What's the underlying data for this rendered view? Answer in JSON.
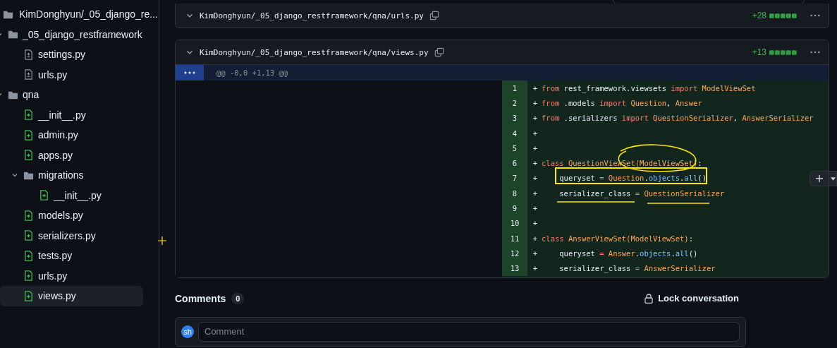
{
  "sidebar": {
    "root": "KimDonghyun/_05_django_re...",
    "tree": [
      {
        "kind": "folder",
        "name": "_05_django_restframework",
        "expanded": true,
        "children": [
          {
            "kind": "modified",
            "name": "settings.py",
            "selected": false
          },
          {
            "kind": "modified",
            "name": "urls.py",
            "selected": false
          }
        ]
      },
      {
        "kind": "folder",
        "name": "qna",
        "expanded": true,
        "children": [
          {
            "kind": "added",
            "name": "__init__.py",
            "selected": false
          },
          {
            "kind": "added",
            "name": "admin.py",
            "selected": false
          },
          {
            "kind": "added",
            "name": "apps.py",
            "selected": false
          },
          {
            "kind": "folder",
            "name": "migrations",
            "expanded": true,
            "children": [
              {
                "kind": "added",
                "name": "__init__.py",
                "selected": false
              }
            ]
          },
          {
            "kind": "added",
            "name": "models.py",
            "selected": false
          },
          {
            "kind": "added",
            "name": "serializers.py",
            "selected": false
          },
          {
            "kind": "added",
            "name": "tests.py",
            "selected": false
          },
          {
            "kind": "added",
            "name": "urls.py",
            "selected": false
          },
          {
            "kind": "added",
            "name": "views.py",
            "selected": true
          }
        ]
      }
    ]
  },
  "files": [
    {
      "path": "KimDonghyun/_05_django_restframework/qna/urls.py",
      "additions": "+28"
    },
    {
      "path": "KimDonghyun/_05_django_restframework/qna/views.py",
      "additions": "+13",
      "hunk": "@@ -0,0 +1,13 @@",
      "lines": [
        {
          "number": "1",
          "tokens": [
            {
              "kind": "keyword",
              "text": "from"
            },
            {
              "kind": "plain",
              "text": " rest_framework.viewsets "
            },
            {
              "kind": "keyword",
              "text": "import"
            },
            {
              "kind": "name",
              "text": " ModelViewSet"
            }
          ]
        },
        {
          "number": "2",
          "tokens": [
            {
              "kind": "keyword",
              "text": "from"
            },
            {
              "kind": "plain",
              "text": " .models "
            },
            {
              "kind": "keyword",
              "text": "import"
            },
            {
              "kind": "name",
              "text": " Question"
            },
            {
              "kind": "plain",
              "text": ", "
            },
            {
              "kind": "name",
              "text": "Answer"
            }
          ]
        },
        {
          "number": "3",
          "tokens": [
            {
              "kind": "keyword",
              "text": "from"
            },
            {
              "kind": "plain",
              "text": " .serializers "
            },
            {
              "kind": "keyword",
              "text": "import"
            },
            {
              "kind": "name",
              "text": " QuestionSerializer"
            },
            {
              "kind": "plain",
              "text": ", "
            },
            {
              "kind": "name",
              "text": "AnswerSerializer"
            }
          ]
        },
        {
          "number": "4"
        },
        {
          "number": "5"
        },
        {
          "number": "6",
          "tokens": [
            {
              "kind": "keyword",
              "text": "class"
            },
            {
              "kind": "name",
              "text": " QuestionViewSet(ModelViewSet)"
            },
            {
              "kind": "plain",
              "text": ":"
            }
          ]
        },
        {
          "number": "7",
          "tokens": [
            {
              "kind": "plain",
              "text": "    queryset "
            },
            {
              "kind": "keyword",
              "text": "="
            },
            {
              "kind": "name",
              "text": " Question"
            },
            {
              "kind": "plain",
              "text": "."
            },
            {
              "kind": "method",
              "text": "objects"
            },
            {
              "kind": "plain",
              "text": "."
            },
            {
              "kind": "method",
              "text": "all"
            },
            {
              "kind": "plain",
              "text": "()"
            }
          ]
        },
        {
          "number": "8",
          "tokens": [
            {
              "kind": "plain",
              "text": "    serializer_class "
            },
            {
              "kind": "keyword",
              "text": "="
            },
            {
              "kind": "name",
              "text": " QuestionSerializer"
            }
          ]
        },
        {
          "number": "9"
        },
        {
          "number": "10"
        },
        {
          "number": "11",
          "tokens": [
            {
              "kind": "keyword",
              "text": "class"
            },
            {
              "kind": "name",
              "text": " AnswerViewSet(ModelViewSet)"
            },
            {
              "kind": "plain",
              "text": ":"
            }
          ]
        },
        {
          "number": "12",
          "tokens": [
            {
              "kind": "plain",
              "text": "    queryset "
            },
            {
              "kind": "keyword",
              "text": "="
            },
            {
              "kind": "name",
              "text": " Answer"
            },
            {
              "kind": "plain",
              "text": "."
            },
            {
              "kind": "method",
              "text": "objects"
            },
            {
              "kind": "plain",
              "text": "."
            },
            {
              "kind": "method",
              "text": "all"
            },
            {
              "kind": "plain",
              "text": "()"
            }
          ]
        },
        {
          "number": "13",
          "tokens": [
            {
              "kind": "plain",
              "text": "    serializer_class "
            },
            {
              "kind": "keyword",
              "text": "="
            },
            {
              "kind": "name",
              "text": " AnswerSerializer"
            }
          ]
        }
      ]
    }
  ],
  "diff_marker": "+",
  "comments": {
    "title": "Comments",
    "count": "0",
    "lock": "Lock conversation",
    "avatar": "sh",
    "placeholder": "Comment"
  }
}
